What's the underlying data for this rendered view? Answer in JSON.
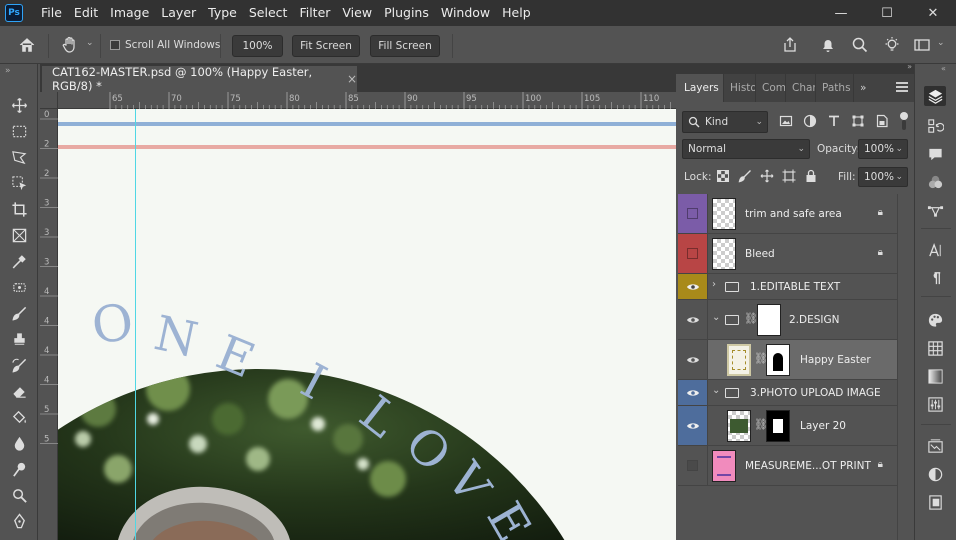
{
  "app": {
    "logo_text": "Ps"
  },
  "menu": [
    "File",
    "Edit",
    "Image",
    "Layer",
    "Type",
    "Select",
    "Filter",
    "View",
    "Plugins",
    "Window",
    "Help"
  ],
  "window_controls": {
    "minimize": "—",
    "maximize": "☐",
    "close": "✕"
  },
  "options_bar": {
    "scroll_all_windows_label": "Scroll All Windows",
    "scroll_all_windows_checked": false,
    "zoom_100_label": "100%",
    "fit_screen_label": "Fit Screen",
    "fill_screen_label": "Fill Screen"
  },
  "document": {
    "tab_title": "CAT162-MASTER.psd @ 100% (Happy Easter, RGB/8) *",
    "close_glyph": "×",
    "ruler_h_labels": [
      "65",
      "70",
      "75",
      "80",
      "85",
      "90",
      "95",
      "100",
      "105",
      "110"
    ],
    "ruler_v_labels": [
      "0",
      "2",
      "2",
      "3",
      "3",
      "3",
      "4",
      "4",
      "4",
      "4",
      "5",
      "5"
    ],
    "canvas_text_chars": [
      "O",
      "N",
      "E",
      "I",
      "L",
      "O",
      "V",
      "E"
    ],
    "canvas_text_color": "#9db3d3",
    "trim_line_color": "#8fb0d6",
    "bleed_line_color": "#e8aaa3",
    "guide_color": "#4fd7e4"
  },
  "layers_panel": {
    "tabs": [
      "Layers",
      "Histo",
      "Com",
      "Char",
      "Paths"
    ],
    "overflow_glyph": "»",
    "filter_kind": "Kind",
    "blend_mode": "Normal",
    "opacity_label": "Opacity:",
    "opacity_value": "100%",
    "lock_label": "Lock:",
    "fill_label": "Fill:",
    "fill_value": "100%",
    "layers": [
      {
        "name": "trim and safe area",
        "visible_color": "#7b5ca8",
        "locked": true,
        "type": "layer"
      },
      {
        "name": "Bleed",
        "visible_color": "#b84545",
        "locked": true,
        "type": "layer"
      },
      {
        "name": "1.EDITABLE TEXT",
        "visible_color": "#a88a1a",
        "locked": false,
        "type": "group-collapsed"
      },
      {
        "name": "2.DESIGN",
        "visible_color": "",
        "locked": false,
        "type": "group-expanded"
      },
      {
        "name": "Happy Easter",
        "visible_color": "",
        "locked": false,
        "type": "masked-layer",
        "selected": true
      },
      {
        "name": "3.PHOTO UPLOAD IMAGE",
        "visible_color": "#4e6d9c",
        "locked": false,
        "type": "group-expanded"
      },
      {
        "name": "Layer 20",
        "visible_color": "#4e6d9c",
        "locked": false,
        "type": "masked-layer"
      },
      {
        "name": "MEASUREME...OT PRINT",
        "visible_color": "",
        "locked": true,
        "type": "layer",
        "hidden": true
      }
    ]
  }
}
